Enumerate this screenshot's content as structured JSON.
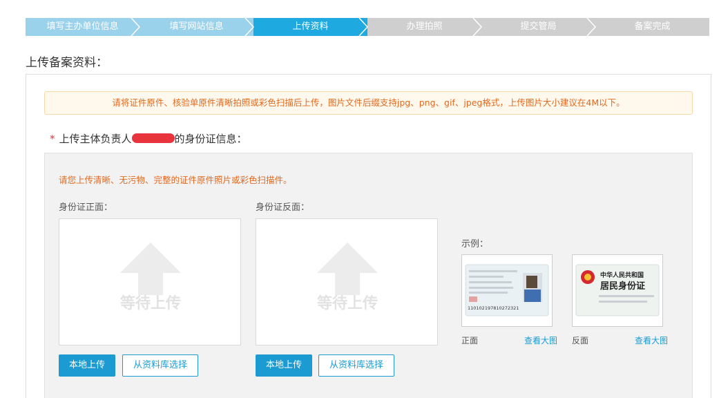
{
  "steps": [
    {
      "label": "填写主办单位信息",
      "state": "done"
    },
    {
      "label": "填写网站信息",
      "state": "done"
    },
    {
      "label": "上传资料",
      "state": "active"
    },
    {
      "label": "办理拍照",
      "state": "todo"
    },
    {
      "label": "提交管局",
      "state": "todo"
    },
    {
      "label": "备案完成",
      "state": "todo"
    }
  ],
  "section_title": "上传备案资料：",
  "notice": "请将证件原件、核验单原件清晰拍照或彩色扫描后上传，图片文件后缀支持jpg、png、gif、jpeg格式，上传图片大小建议在4M以下。",
  "id_section": {
    "required_mark": "*",
    "title_prefix": "上传主体负责人",
    "title_suffix": "的身份证信息：",
    "hint": "请您上传清晰、无污物、完整的证件原件照片或彩色扫描件。",
    "front_label": "身份证正面：",
    "back_label": "身份证反面：",
    "placeholder_text": "等待上传",
    "local_upload_label": "本地上传",
    "library_select_label": "从资料库选择",
    "example_label": "示例：",
    "sample_front_caption": "正面",
    "sample_back_caption": "反面",
    "view_large_label": "查看大图",
    "sample_id_number": "110102197810272321",
    "sample_back_title_1": "中华人民共和国",
    "sample_back_title_2": "居民身份证"
  },
  "colors": {
    "accent": "#1b9bd1",
    "step_active": "#1eaae0",
    "step_done": "#9ad1eb",
    "step_todo": "#cfcfcf",
    "warning_text": "#e2691e",
    "required": "#e4393c"
  }
}
